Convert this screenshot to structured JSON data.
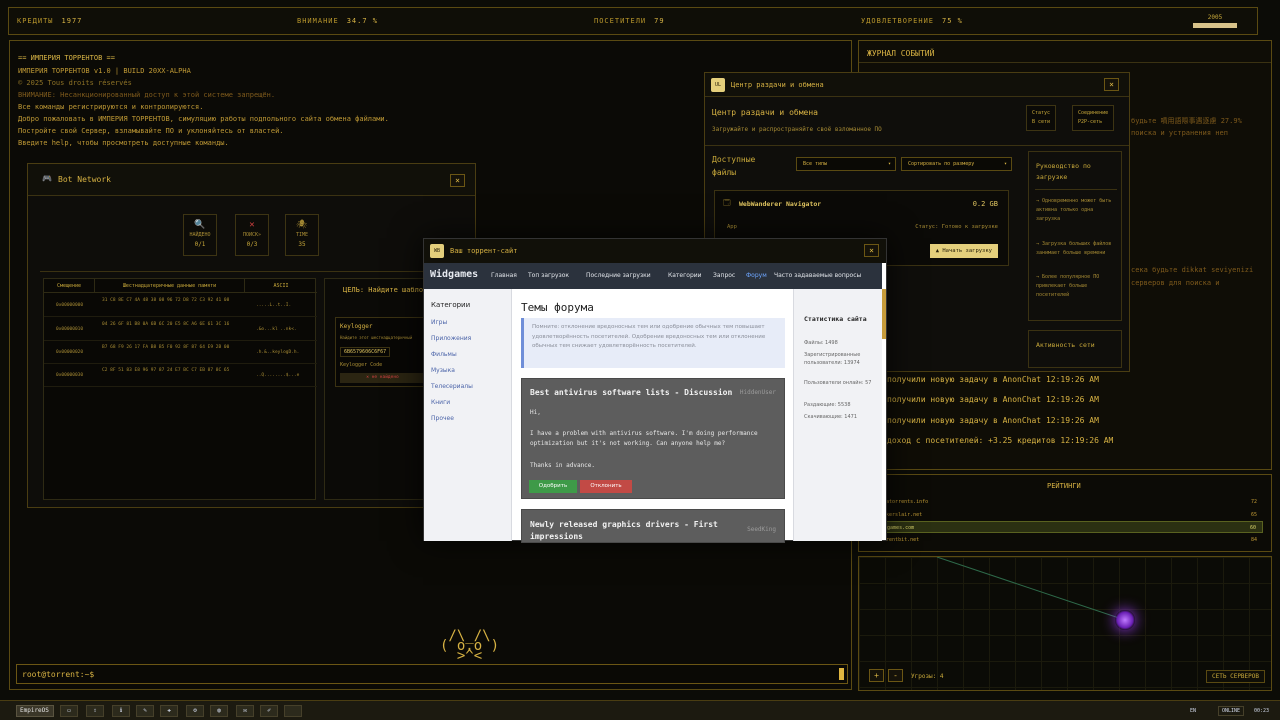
{
  "topbar": {
    "credits_label": "КРЕДИТЫ",
    "credits_value": "1977",
    "attention_label": "ВНИМАНИЕ",
    "attention_value": "34.7 %",
    "visitors_label": "ПОСЕТИТЕЛИ",
    "visitors_value": "79",
    "satisfaction_label": "УДОВЛЕТВОРЕНИЕ",
    "satisfaction_value": "75 %",
    "year": "2005"
  },
  "terminal": {
    "lines": [
      "== ИМПЕРИЯ ТОРРЕНТОВ ==",
      "ИМПЕРИЯ ТОРРЕНТОВ v1.0 | BUILD 20XX-ALPHA",
      "© 2025 Tous droits réservés",
      "ВНИМАНИЕ: Несанкционированный доступ к этой системе запрещён.",
      "Все команды регистрируются и контролируются.",
      "Добро пожаловать в ИМПЕРИЯ ТОРРЕНТОВ, симуляцию работы подпольного сайта обмена файлами.",
      "Постройте свой Сервер, взламывайте ПО и уклоняйтесь от властей.",
      "Введите help, чтобы просмотреть доступные команды."
    ],
    "prompt": "root@torrent:~$"
  },
  "bot_network": {
    "title": "Bot Network",
    "close": "×",
    "stats": [
      {
        "icon": "🔍",
        "label": "НАЙДЕНО",
        "value": "0/1"
      },
      {
        "icon": "✕",
        "label": "ПОИСК»",
        "value": "0/3"
      },
      {
        "icon": "🕷",
        "label": "TIME",
        "value": "35"
      }
    ],
    "table_headers": [
      "Смещение",
      "Шестнадцатеричные данные памяти",
      "ASCII"
    ],
    "rows": [
      {
        "offset": "0x00000000",
        "hex": "31 C8 8E C7 4A 48 38 08 96 72 D8 72 C3 92 41 08",
        "ascii": ".....L..t..I."
      },
      {
        "offset": "0x00000010",
        "hex": "04 26 6F 81 B8 0A 6B 6C 20 E5 8C A6 6E 61 3C 16",
        "ascii": ".&o...kl ..nk<."
      },
      {
        "offset": "0x00000020",
        "hex": "B7 68 F9 26 17 FA B8 B5 F0 92 8F 87 64 E9 2B 00",
        "ascii": ".h.&..keylogD.h."
      },
      {
        "offset": "0x00000030",
        "hex": "C2 8F 51 83 E8 96 97 87 24 E7 BC C7 EB 87 8C 65",
        "ascii": "..Q........$...e"
      }
    ],
    "target_title": "ЦЕЛЬ: Найдите шаблон",
    "target_item": "Keylogger",
    "target_desc": "Найдите этот шестнадцатеричный",
    "target_hex": "6B6579606C6F67",
    "target_code": "Keylogger Code",
    "target_status": "✕ не найдено"
  },
  "events": {
    "title": "ЖУРНАЛ СОБЫТИЙ",
    "bg_text_1": "будьте 噴用語際事遇逐慮 27.9%",
    "bg_text_2": "поиска и устранения неп",
    "bg_text_3": "сека будьте dikkat seviyenizi",
    "bg_text_4": "серверов для поиска и",
    "items": [
      "получили новую задачу в AnonChat 12:19:26 AM",
      "получили новую задачу в AnonChat 12:19:26 AM",
      "получили новую задачу в AnonChat 12:19:26 AM",
      "доход с посетителей: +3.25 кредитов 12:19:26 AM"
    ]
  },
  "ratings": {
    "title": "РЕЙТИНГИ",
    "rows": [
      {
        "name": "piratorrents.info",
        "score": "72"
      },
      {
        "name": "hackerslair.net",
        "score": "65"
      },
      {
        "name": "widgames.com",
        "score": "60"
      },
      {
        "name": "torrentbit.net",
        "score": "84"
      }
    ]
  },
  "server_network": {
    "threats_label": "Угрозы: 4",
    "plus": "+",
    "minus": "-",
    "button": "СЕТЬ СЕРВЕРОВ"
  },
  "center": {
    "icon": "UL",
    "window_title": "Центр раздачи и обмена",
    "heading": "Центр раздачи и обмена",
    "subtitle": "Загружайте и распространяйте своё взломанное ПО",
    "status_label": "Статус",
    "status_value": "В сети",
    "conn_label": "Соединение",
    "conn_value": "P2P-сеть",
    "available": "Доступные файлы",
    "filter_types": "Все типы",
    "sort": "Сортировать по размеру",
    "file_name": "WebWanderer Navigator",
    "file_size": "0.2 GB",
    "file_type": "App",
    "file_status": "Статус: Готово к загрузке",
    "upload_btn": "▲ Начать загрузку",
    "guide_title": "Руководство по загрузке",
    "guide_items": [
      "→ Одновременно может быть активна только одна загрузка",
      "→ Загрузка больших файлов занимает больше времени",
      "→ Более популярное ПО привлекает больше посетителей"
    ],
    "activity_title": "Активность сети"
  },
  "forum": {
    "icon": "WB",
    "window_title": "Ваш торрент-сайт",
    "brand": "Widgames",
    "nav": [
      "Главная",
      "Топ загрузок",
      "Последние загрузки",
      "Категории",
      "Запрос",
      "Форум",
      "Часто задаваемые вопросы"
    ],
    "categories_title": "Категории",
    "categories": [
      "Игры",
      "Приложения",
      "Фильмы",
      "Музыка",
      "Телесериалы",
      "Книги",
      "Прочее"
    ],
    "main_title": "Темы форума",
    "notice": "Помните: отклонение вредоносных тем или одобрение обычных тем повышает удовлетворённость посетителей. Одобрение вредоносных тем или отклонение обычных тем снижает удовлетворённость посетителей.",
    "posts": [
      {
        "title": "Best antivirus software lists - Discussion",
        "user": "HiddenUser",
        "body1": "Hi,",
        "body2": "I have a problem with antivirus software. I'm doing performance",
        "body3": "optimization but it's not working. Can anyone help me?",
        "body4": "Thanks in advance.",
        "approve": "Одобрить",
        "reject": "Отклонить"
      },
      {
        "title": "Newly released graphics drivers - First impressions",
        "user": "SeedKing"
      }
    ],
    "stats_title": "Статистика сайта",
    "stats": [
      "Файлы: 1498",
      "Зарегистрированные пользователи: 13974",
      "Пользователи онлайн: 57",
      "Раздающие: 5538",
      "Скачивающие: 1471"
    ]
  },
  "taskbar": {
    "start": "EmpireOS",
    "online": "ONLINE",
    "time": "00:23",
    "lang": "EN"
  }
}
